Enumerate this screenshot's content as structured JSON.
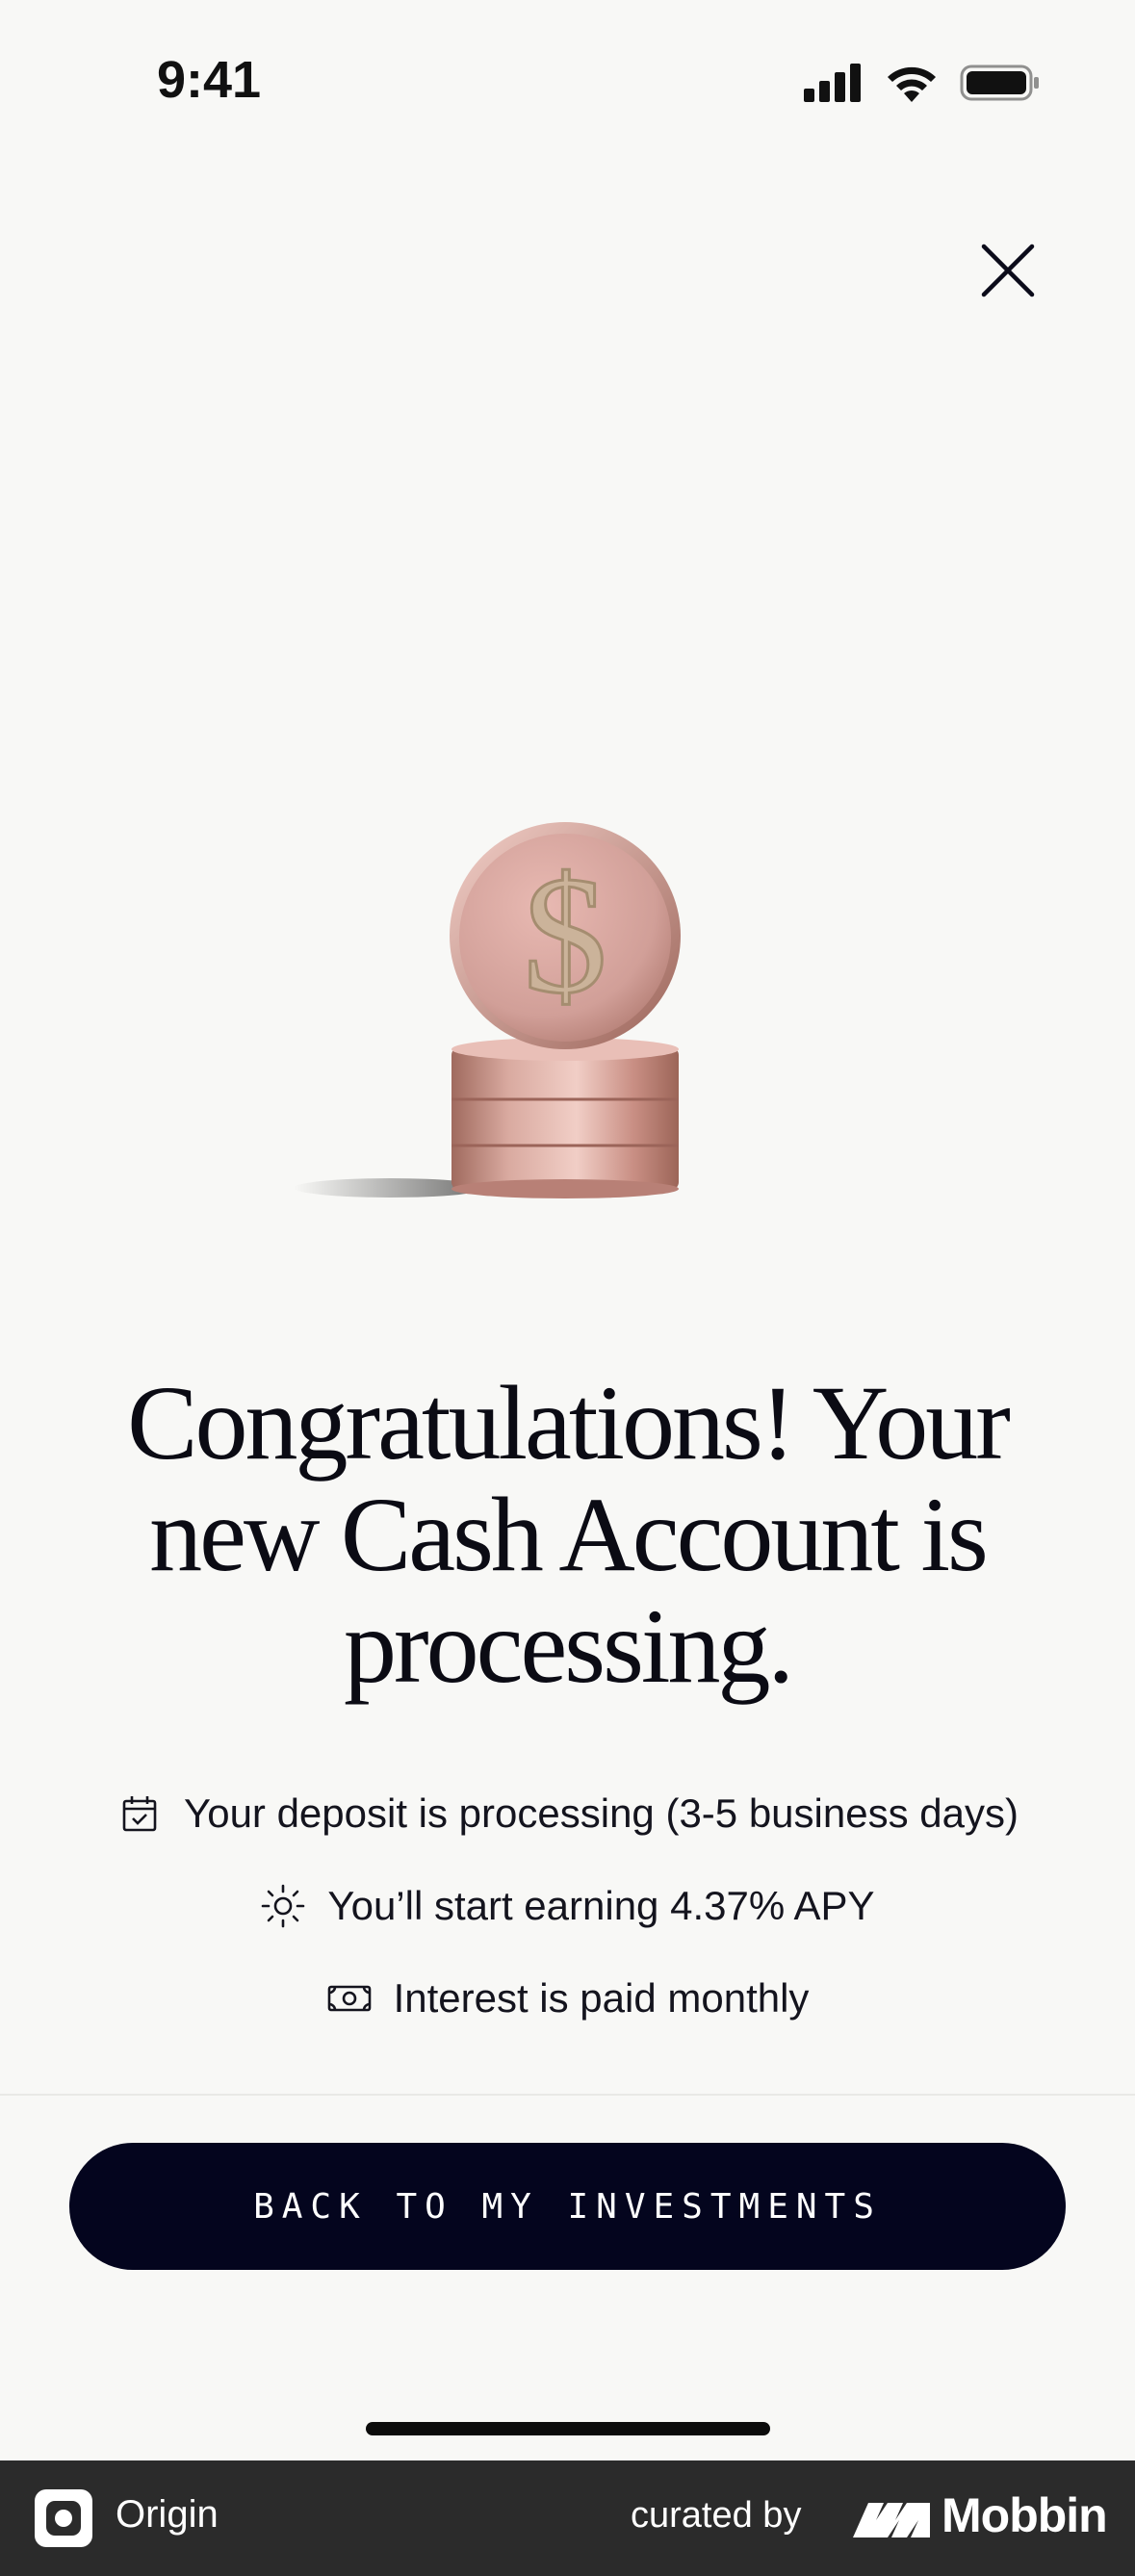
{
  "status_bar": {
    "time": "9:41"
  },
  "hero": {
    "headline_line1": "Congratulations! Your",
    "headline_line2": "new Cash Account is",
    "headline_line3": "processing."
  },
  "features": [
    {
      "icon": "calendar-check-icon",
      "text": "Your deposit is processing (3-5 business days)"
    },
    {
      "icon": "sun-icon",
      "text": "You’ll start earning 4.37% APY"
    },
    {
      "icon": "cash-bill-icon",
      "text": "Interest is paid monthly"
    }
  ],
  "cta": {
    "label": "BACK TO MY INVESTMENTS"
  },
  "footer": {
    "app_name": "Origin",
    "curated_by": "curated by",
    "brand": "Mobbin"
  },
  "colors": {
    "background": "#f8f8f6",
    "button": "#04051e",
    "footer": "#2b2b2b"
  }
}
